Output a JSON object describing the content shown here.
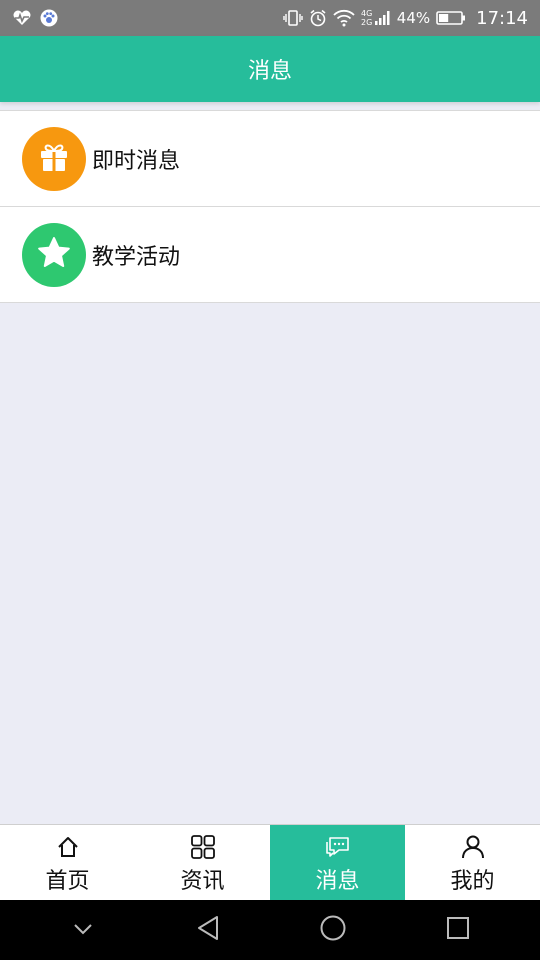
{
  "status_bar": {
    "battery_percent": "44%",
    "time": "17:14",
    "network_top": "4G",
    "network_bottom": "2G",
    "battery_level": 0.44
  },
  "header": {
    "title": "消息"
  },
  "messages": {
    "items": [
      {
        "label": "即时消息",
        "icon": "gift-icon",
        "color": "#f7980f"
      },
      {
        "label": "教学活动",
        "icon": "star-icon",
        "color": "#2ec870"
      }
    ]
  },
  "tabs": [
    {
      "label": "首页",
      "icon": "home-icon",
      "active": false
    },
    {
      "label": "资讯",
      "icon": "grid-icon",
      "active": false
    },
    {
      "label": "消息",
      "icon": "chat-icon",
      "active": true
    },
    {
      "label": "我的",
      "icon": "person-icon",
      "active": false
    }
  ],
  "colors": {
    "accent": "#26bd9b",
    "background": "#ebecf5"
  }
}
